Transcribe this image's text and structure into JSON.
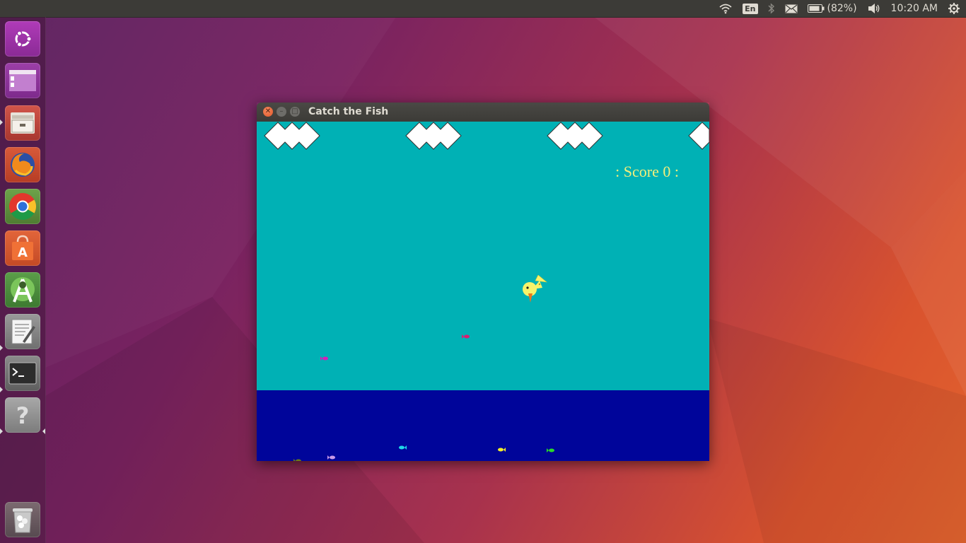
{
  "top_panel": {
    "lang": "En",
    "battery": "(82%)",
    "clock": "10:20 AM"
  },
  "launcher": {
    "items": [
      "ubuntu-dash",
      "workspace-switcher",
      "files",
      "firefox",
      "chrome",
      "software-center",
      "android-studio",
      "text-editor",
      "terminal",
      "help",
      "trash"
    ]
  },
  "window": {
    "title": "Catch the Fish",
    "score_label": ": Score 0 :"
  },
  "game": {
    "score": 0,
    "colors": {
      "sky": "#00b1b5",
      "sea": "#00059a",
      "score_text": "#f5ef7a",
      "bird": "#f7f36a",
      "beak": "#e8761f"
    },
    "fish": [
      {
        "name": "fish-magenta",
        "color": "#d81fb8"
      },
      {
        "name": "fish-pink",
        "color": "#d81f70"
      },
      {
        "name": "fish-cyan",
        "color": "#1fd8e8"
      },
      {
        "name": "fish-yellow",
        "color": "#f5ef2a"
      },
      {
        "name": "fish-green",
        "color": "#2ad82a"
      },
      {
        "name": "fish-olive",
        "color": "#6a7a1a"
      },
      {
        "name": "fish-lavender",
        "color": "#c89ae8"
      }
    ]
  }
}
